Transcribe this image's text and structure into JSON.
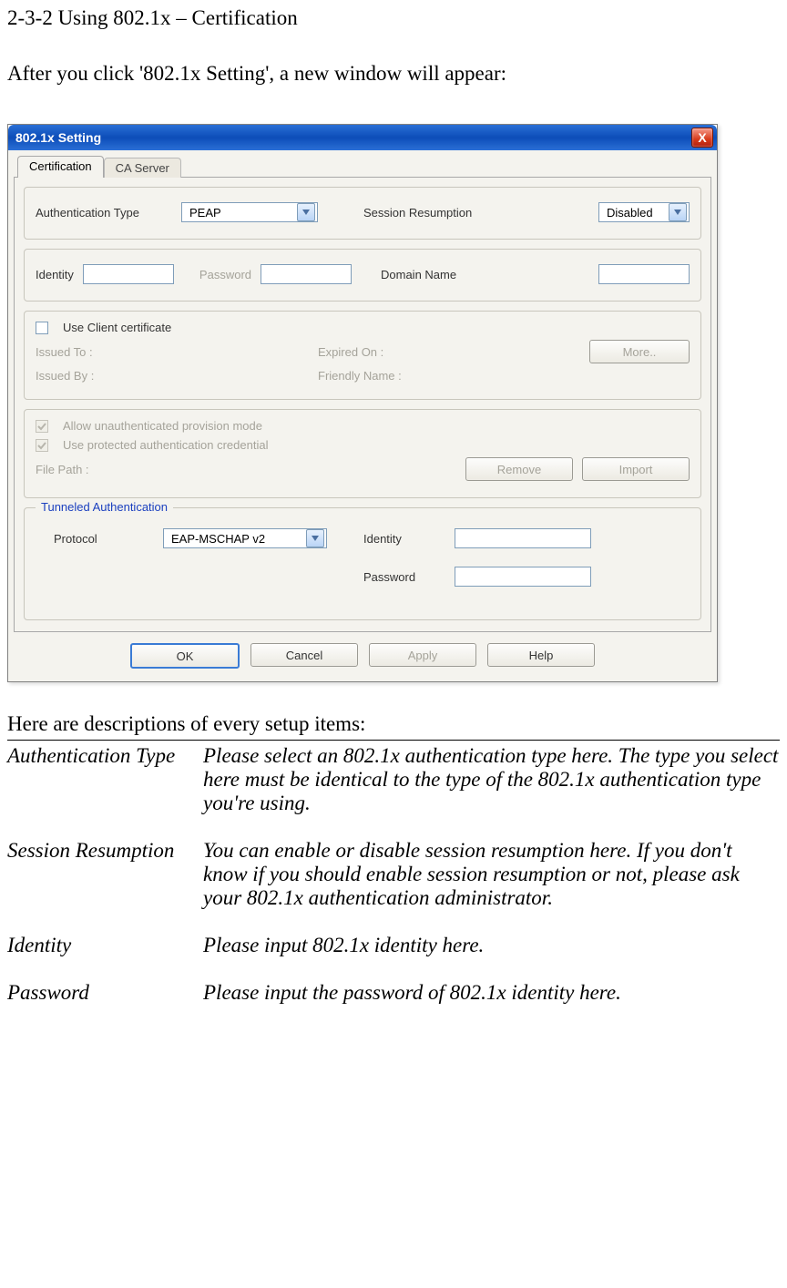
{
  "doc": {
    "heading": "2-3-2 Using 802.1x – Certification",
    "intro": "After you click '802.1x Setting', a new window will appear:",
    "descriptions_intro": "Here are descriptions of every setup items:"
  },
  "dialog": {
    "title": "802.1x Setting",
    "close_glyph": "X",
    "tabs": {
      "cert": "Certification",
      "ca": "CA Server"
    },
    "auth_type_label": "Authentication Type",
    "auth_type_value": "PEAP",
    "session_resumption_label": "Session Resumption",
    "session_resumption_value": "Disabled",
    "identity_label": "Identity",
    "identity_value": "",
    "password_label": "Password",
    "password_value": "",
    "domain_label": "Domain Name",
    "domain_value": "",
    "use_client_cert_label": "Use Client certificate",
    "issued_to_label": "Issued To :",
    "expired_on_label": "Expired On :",
    "issued_by_label": "Issued By :",
    "friendly_name_label": "Friendly Name :",
    "more_btn": "More..",
    "allow_unauth_label": "Allow unauthenticated provision mode",
    "use_protected_label": "Use protected authentication credential",
    "file_path_label": "File Path :",
    "remove_btn": "Remove",
    "import_btn": "Import",
    "tunneled_legend": "Tunneled Authentication",
    "protocol_label": "Protocol",
    "protocol_value": "EAP-MSCHAP v2",
    "tunnel_identity_label": "Identity",
    "tunnel_identity_value": "",
    "tunnel_password_label": "Password",
    "tunnel_password_value": "",
    "ok_btn": "OK",
    "cancel_btn": "Cancel",
    "apply_btn": "Apply",
    "help_btn": "Help"
  },
  "desc": {
    "items": [
      {
        "term": "Authentication Type",
        "text": "Please select an 802.1x authentication type here. The type you select here must be identical to the type of the 802.1x authentication type you're using."
      },
      {
        "term": "Session Resumption",
        "text": "You can enable or disable session resumption here. If you don't know if you should enable session resumption or not, please ask your 802.1x authentication administrator."
      },
      {
        "term": "Identity",
        "text": "Please input 802.1x identity here."
      },
      {
        "term": "Password",
        "text": "Please input the password of 802.1x identity here."
      }
    ]
  }
}
